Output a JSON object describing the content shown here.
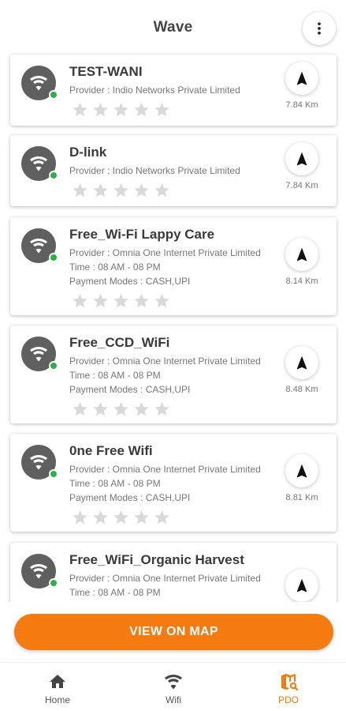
{
  "app": {
    "title": "Wave"
  },
  "header": {
    "menu_icon": "more-vertical-icon"
  },
  "hotspots": [
    {
      "name": "TEST-WANI",
      "provider": "Provider : Indio Networks Private Limited",
      "time": "",
      "payment": "",
      "distance": "7.84 Km",
      "rating": 0
    },
    {
      "name": "D-link",
      "provider": "Provider : Indio Networks Private Limited",
      "time": "",
      "payment": "",
      "distance": "7.84 Km",
      "rating": 0
    },
    {
      "name": " Free_Wi-Fi Lappy Care",
      "provider": "Provider : Omnia One Internet Private Limited",
      "time": "Time : 08 AM - 08 PM",
      "payment": "Payment Modes : CASH,UPI",
      "distance": "8.14 Km",
      "rating": 0
    },
    {
      "name": " Free_CCD_WiFi",
      "provider": "Provider : Omnia One Internet Private Limited",
      "time": "Time : 08 AM - 08 PM",
      "payment": "Payment Modes : CASH,UPI",
      "distance": "8.48 Km",
      "rating": 0
    },
    {
      "name": "0ne Free Wifi",
      "provider": "Provider : Omnia One Internet Private Limited",
      "time": "Time : 08 AM - 08 PM",
      "payment": "Payment Modes : CASH,UPI",
      "distance": "8.81 Km",
      "rating": 0
    },
    {
      "name": " Free_WiFi_Organic Harvest",
      "provider": "Provider : Omnia One Internet Private Limited",
      "time": "Time : 08 AM - 08 PM",
      "payment": "",
      "distance": "",
      "rating": 0
    }
  ],
  "actions": {
    "view_on_map": "VIEW ON MAP"
  },
  "bottom_nav": [
    {
      "label": "Home",
      "icon": "home-icon"
    },
    {
      "label": "Wifi",
      "icon": "wifi-icon"
    },
    {
      "label": "PDO",
      "icon": "map-search-icon",
      "active": true
    }
  ],
  "colors": {
    "accent": "#f57a10",
    "online": "#2fae4a",
    "avatar": "#5f5f5f",
    "star_empty": "#d9d9d9"
  }
}
